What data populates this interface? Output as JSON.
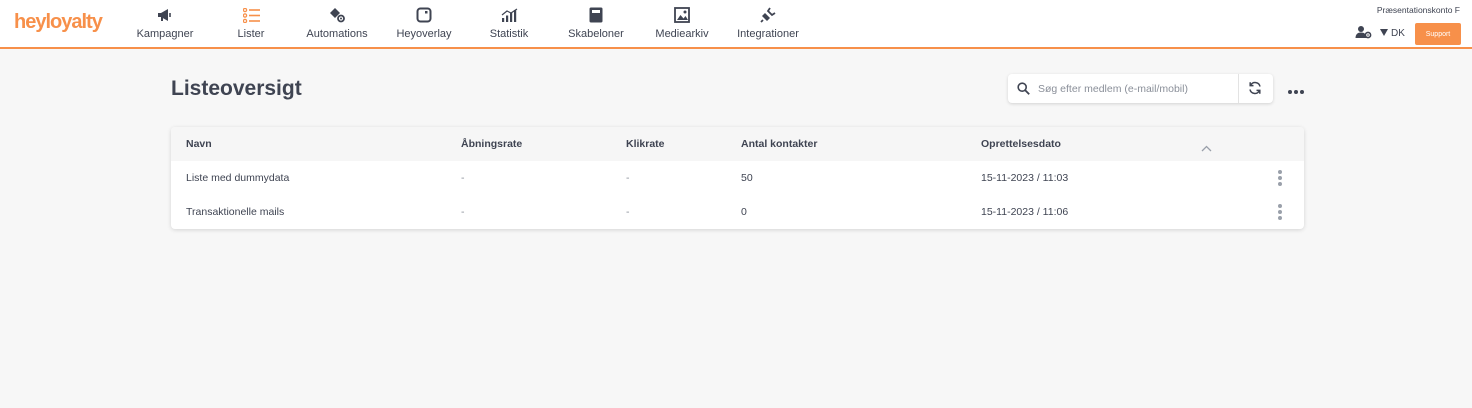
{
  "brand": {
    "logo_text": "heyloyalty",
    "accent_color": "#f7904a"
  },
  "nav": {
    "items": [
      {
        "label": "Kampagner",
        "icon": "megaphone-icon",
        "active": false
      },
      {
        "label": "Lister",
        "icon": "list-icon",
        "active": true
      },
      {
        "label": "Automations",
        "icon": "automations-gear-icon",
        "active": false
      },
      {
        "label": "Heyoverlay",
        "icon": "overlay-icon",
        "active": false
      },
      {
        "label": "Statistik",
        "icon": "bar-chart-icon",
        "active": false
      },
      {
        "label": "Skabeloner",
        "icon": "template-icon",
        "active": false
      },
      {
        "label": "Mediearkiv",
        "icon": "image-icon",
        "active": false
      },
      {
        "label": "Integrationer",
        "icon": "plug-icon",
        "active": false
      }
    ]
  },
  "account": {
    "name": "Præsentationskonto F",
    "user_icon": "user-settings-icon",
    "language": "DK",
    "support_label": "Support"
  },
  "page": {
    "title": "Listeoversigt"
  },
  "search": {
    "placeholder": "Søg efter medlem (e-mail/mobil)",
    "value": ""
  },
  "table": {
    "columns": [
      "Navn",
      "Åbningsrate",
      "Klikrate",
      "Antal kontakter",
      "Oprettelsesdato"
    ],
    "rows": [
      {
        "name": "Liste med dummydata",
        "open_rate": "-",
        "click_rate": "-",
        "contacts": "50",
        "created": "15-11-2023 / 11:03"
      },
      {
        "name": "Transaktionelle mails",
        "open_rate": "-",
        "click_rate": "-",
        "contacts": "0",
        "created": "15-11-2023 / 11:06"
      }
    ]
  }
}
